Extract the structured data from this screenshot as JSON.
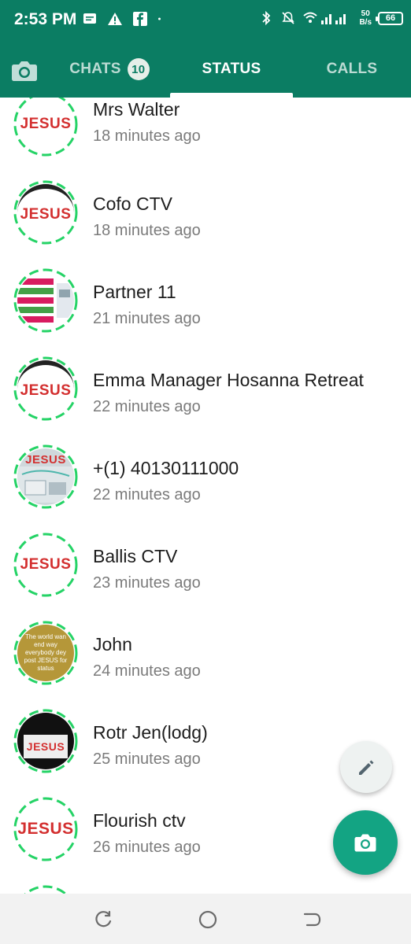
{
  "status_bar": {
    "time": "2:53 PM",
    "net_speed_value": "50",
    "net_speed_unit": "B/s",
    "battery": "66"
  },
  "tabs": {
    "chats_label": "CHATS",
    "chats_badge": "10",
    "status_label": "STATUS",
    "calls_label": "CALLS"
  },
  "avatar_text": "JESUS",
  "statuses": [
    {
      "name": "Mrs Walter",
      "time": "18 minutes ago"
    },
    {
      "name": "Cofo CTV",
      "time": "18 minutes ago"
    },
    {
      "name": "Partner 11",
      "time": "21 minutes ago"
    },
    {
      "name": "Emma Manager Hosanna Retreat",
      "time": "22 minutes ago"
    },
    {
      "name": "+(1) 40130111000",
      "time": "22 minutes ago"
    },
    {
      "name": "Ballis CTV",
      "time": "23 minutes ago"
    },
    {
      "name": "John",
      "time": "24 minutes ago",
      "avatar_caption": "The world wan end way everybody dey post JESUS for status"
    },
    {
      "name": "Rotr Jen(lodg)",
      "time": "25 minutes ago"
    },
    {
      "name": "Flourish ctv",
      "time": "26 minutes ago"
    }
  ],
  "colors": {
    "header": "#0b7d63",
    "ring": "#25d366",
    "fab": "#13a483",
    "jesus_red": "#d32f2f"
  }
}
